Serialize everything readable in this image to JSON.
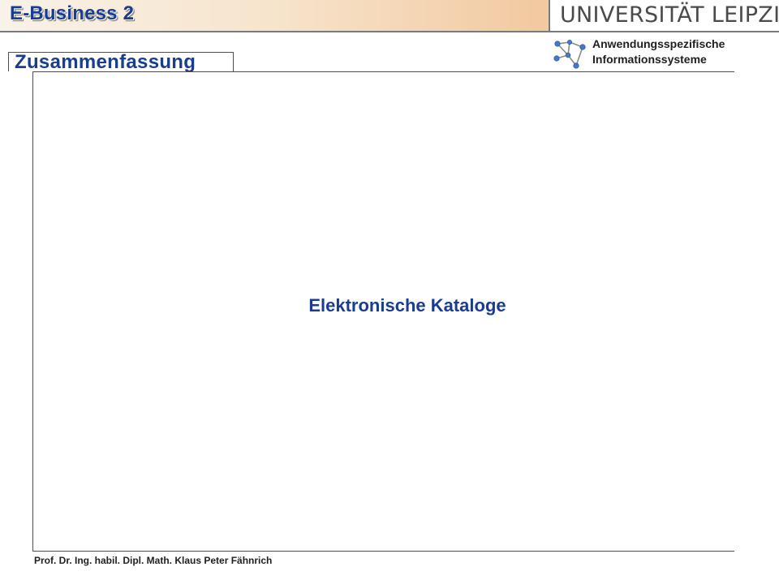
{
  "header": {
    "course_title": "E-Business 2",
    "university_logo_text": "UNIVERSITÄT LEIPZIG",
    "institute_line1": "Anwendungsspezifische",
    "institute_line2": "Informationssysteme"
  },
  "section": {
    "title": "Zusammenfassung"
  },
  "main": {
    "heading": "Elektronische Kataloge"
  },
  "footer": {
    "author": "Prof. Dr. Ing. habil. Dipl. Math. Klaus Peter Fähnrich"
  },
  "colors": {
    "title_blue": "#1a3d8f",
    "header_gradient_start": "#f8f2e9",
    "header_gradient_end": "#eab88a",
    "frame_gray": "#4f4f4f"
  },
  "icons": {
    "institute_logo": "network-nodes-icon"
  }
}
